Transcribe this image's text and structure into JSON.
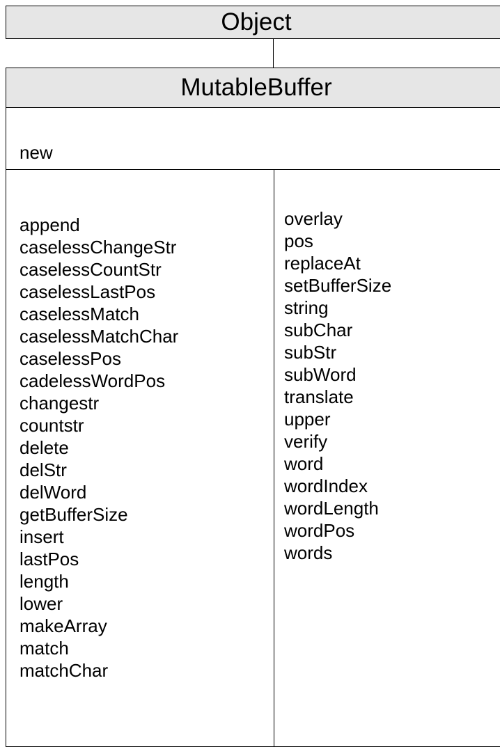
{
  "superclass": {
    "name": "Object"
  },
  "class": {
    "name": "MutableBuffer",
    "class_methods": [
      "new"
    ],
    "instance_methods_left": [
      "append",
      "caselessChangeStr",
      "caselessCountStr",
      "caselessLastPos",
      "caselessMatch",
      "caselessMatchChar",
      "caselessPos",
      "cadelessWordPos",
      "changestr",
      "countstr",
      "delete",
      "delStr",
      "delWord",
      "getBufferSize",
      "insert",
      "lastPos",
      "length",
      "lower",
      "makeArray",
      "match",
      "matchChar"
    ],
    "instance_methods_right": [
      "overlay",
      "pos",
      "replaceAt",
      "setBufferSize",
      "string",
      "subChar",
      "subStr",
      "subWord",
      "translate",
      "upper",
      "verify",
      "word",
      "wordIndex",
      "wordLength",
      "wordPos",
      "words"
    ]
  },
  "colors": {
    "header_fill": "#e6e6e6",
    "border": "#000000",
    "background": "#ffffff"
  }
}
